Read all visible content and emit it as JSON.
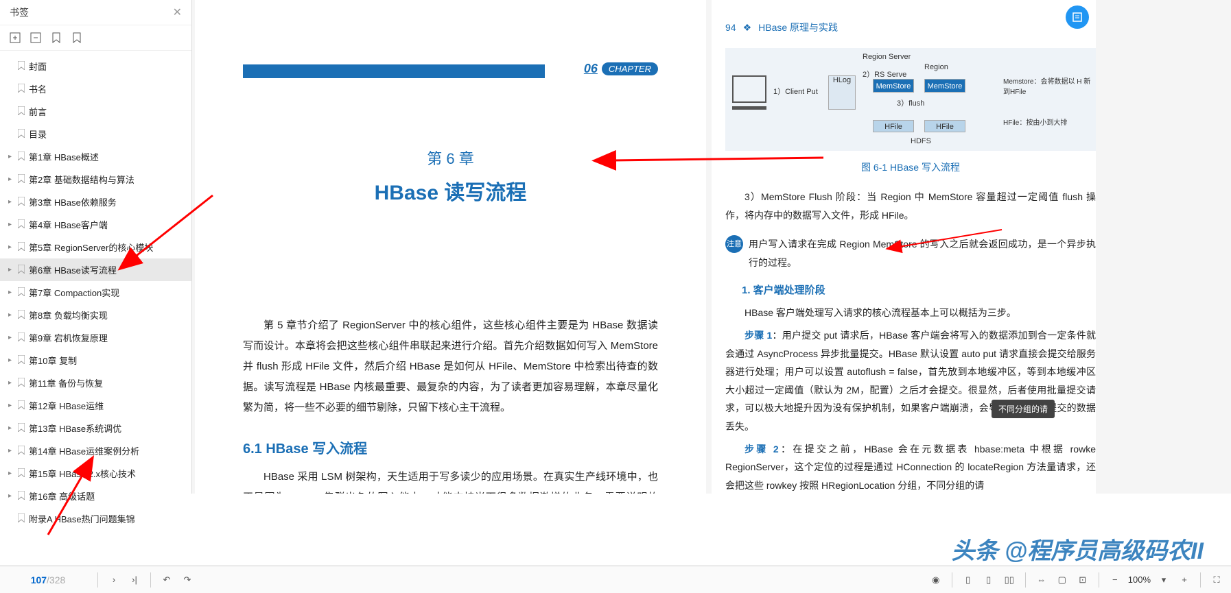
{
  "sidebar": {
    "title": "书签",
    "items": [
      {
        "label": "封面",
        "expandable": false
      },
      {
        "label": "书名",
        "expandable": false
      },
      {
        "label": "前言",
        "expandable": false
      },
      {
        "label": "目录",
        "expandable": false
      },
      {
        "label": "第1章 HBase概述",
        "expandable": true
      },
      {
        "label": "第2章 基础数据结构与算法",
        "expandable": true
      },
      {
        "label": "第3章 HBase依赖服务",
        "expandable": true
      },
      {
        "label": "第4章 HBase客户端",
        "expandable": true
      },
      {
        "label": "第5章 RegionServer的核心模块",
        "expandable": true
      },
      {
        "label": "第6章 HBase读写流程",
        "expandable": true,
        "selected": true
      },
      {
        "label": "第7章 Compaction实现",
        "expandable": true
      },
      {
        "label": "第8章 负载均衡实现",
        "expandable": true
      },
      {
        "label": "第9章 宕机恢复原理",
        "expandable": true
      },
      {
        "label": "第10章 复制",
        "expandable": true
      },
      {
        "label": "第11章 备份与恢复",
        "expandable": true
      },
      {
        "label": "第12章 HBase运维",
        "expandable": true
      },
      {
        "label": "第13章 HBase系统调优",
        "expandable": true
      },
      {
        "label": "第14章 HBase运维案例分析",
        "expandable": true
      },
      {
        "label": "第15章 HBase 2.x核心技术",
        "expandable": true
      },
      {
        "label": "第16章 高级话题",
        "expandable": true
      },
      {
        "label": "附录A   HBase热门问题集锦",
        "expandable": false
      }
    ]
  },
  "page1": {
    "chapter_num": "06",
    "chapter_word": "CHAPTER",
    "chapter_label": "第 6 章",
    "chapter_title": "HBase 读写流程",
    "intro": "第 5 章节介绍了 RegionServer 中的核心组件，这些核心组件主要是为 HBase 数据读写而设计。本章将会把这些核心组件串联起来进行介绍。首先介绍数据如何写入 MemStore 并 flush 形成 HFile 文件，然后介绍 HBase 是如何从 HFile、MemStore 中检索出待查的数据。读写流程是 HBase 内核最重要、最复杂的内容，为了读者更加容易理解，本章尽量化繁为简，将一些不必要的细节剔除，只留下核心主干流程。",
    "section1": "6.1    HBase 写入流程",
    "section1_body": "HBase 采用 LSM 树架构，天生适用于写多读少的应用场景。在真实生产线环境中，也正是因为 HBase 集群出色的写入能力，才能支持当下很多数据激增的业务。需要说明的是，HBase 服务端并没有提供 update、delete 接口，HBase 中对数据的更新、删除操作在服务器端也认为是写入操作，不同的是，更新操作会写入一个最新版本数据，删除操作会写入一条标记为 deleted 的 KV 数据。所以 HBase 中更新、删除操作的流程与写入流程完全一致。当然，HBase 数据写入的整个流程随着版本的迭代在不断优化，但总体流程变化不大。"
  },
  "page2": {
    "pagenum": "94",
    "booktitle": "HBase 原理与实践",
    "fig_caption": "图 6-1   HBase 写入流程",
    "diagram": {
      "region_server": "Region Server",
      "region": "Region",
      "client_put": "1）Client Put",
      "rs_serve": "2）RS Serve",
      "hlog": "HLog",
      "memstore": "MemStore",
      "flush": "3）flush",
      "hfile": "HFile",
      "hdfs": "HDFS",
      "side1": "Memstore：会将数据以 H 新到HFile",
      "side2": "HFile：按由小到大排"
    },
    "para1": "3）MemStore Flush 阶段：当 Region 中 MemStore 容量超过一定阈值 flush 操作，将内存中的数据写入文件，形成 HFile。",
    "note_label": "注意",
    "note_text": "用户写入请求在完成 Region MemStore 的写入之后就会返回成功，是一个异步执行的过程。",
    "sub1": "1. 客户端处理阶段",
    "sub1_intro": "HBase 客户端处理写入请求的核心流程基本上可以概括为三步。",
    "step1_label": "步骤 1",
    "step1_text": "：用户提交 put 请求后，HBase 客户端会将写入的数据添加到合一定条件就会通过 AsyncProcess 异步批量提交。HBase 默认设置 auto put 请求直接会提交给服务器进行处理；用户可以设置 autoflush = false，首先放到本地缓冲区，等到本地缓冲区大小超过一定阈值（默认为 2M，配置）之后才会提交。很显然，后者使用批量提交请求，可以极大地提升因为没有保护机制，如果客户端崩溃，会导致部分已经提交的数据丢失。",
    "step2_label": "步骤 2",
    "step2_text": "：在提交之前，HBase 会在元数据表 hbase:meta 中根据 rowke RegionServer，这个定位的过程是通过 HConnection 的 locateRegion 方法量请求，还会把这些 rowkey 按照 HRegionLocation 分组，不同分组的请"
  },
  "tooltip": "不同分组的请",
  "watermark": "头条 @程序员高级码农II",
  "bottombar": {
    "current_page": "107",
    "total_pages": "/328",
    "zoom": "100%"
  }
}
